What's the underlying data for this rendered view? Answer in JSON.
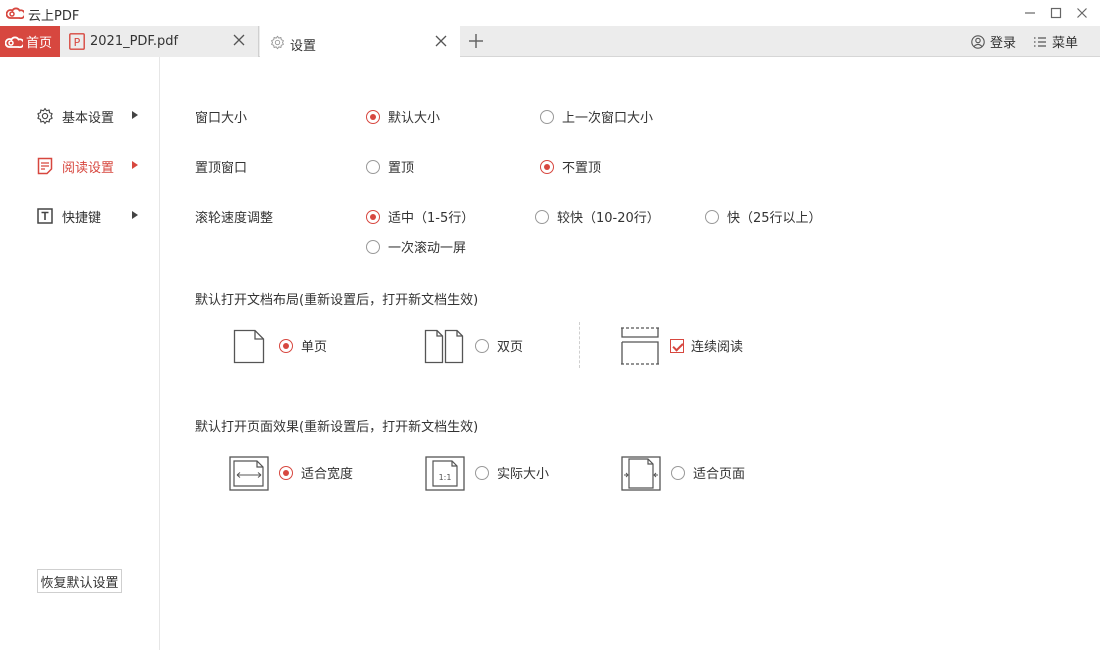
{
  "app": {
    "title": "云上PDF"
  },
  "tabs": {
    "home_label": "首页",
    "file_label": "2021_PDF.pdf",
    "settings_label": "设置",
    "login_label": "登录",
    "menu_label": "菜单"
  },
  "sidebar": {
    "items": [
      {
        "label": "基本设置",
        "icon": "gear-icon"
      },
      {
        "label": "阅读设置",
        "icon": "document-icon"
      },
      {
        "label": "快捷键",
        "icon": "text-box-icon"
      }
    ],
    "restore_label": "恢复默认设置"
  },
  "settings": {
    "window_size": {
      "label": "窗口大小",
      "options": [
        "默认大小",
        "上一次窗口大小"
      ],
      "selected": "默认大小"
    },
    "pin_window": {
      "label": "置顶窗口",
      "options": [
        "置顶",
        "不置顶"
      ],
      "selected": "不置顶"
    },
    "scroll_speed": {
      "label": "滚轮速度调整",
      "options": [
        "适中（1-5行）",
        "较快（10-20行）",
        "快（25行以上）",
        "一次滚动一屏"
      ],
      "selected": "适中（1-5行）"
    },
    "layout": {
      "label": "默认打开文档布局(重新设置后，打开新文档生效)",
      "options": [
        "单页",
        "双页"
      ],
      "selected": "单页",
      "continuous_label": "连续阅读",
      "continuous_checked": true
    },
    "page_effect": {
      "label": "默认打开页面效果(重新设置后，打开新文档生效)",
      "options": [
        "适合宽度",
        "实际大小",
        "适合页面"
      ],
      "selected": "适合宽度"
    }
  },
  "colors": {
    "accent": "#d7473f",
    "tabbar": "#ececec"
  }
}
